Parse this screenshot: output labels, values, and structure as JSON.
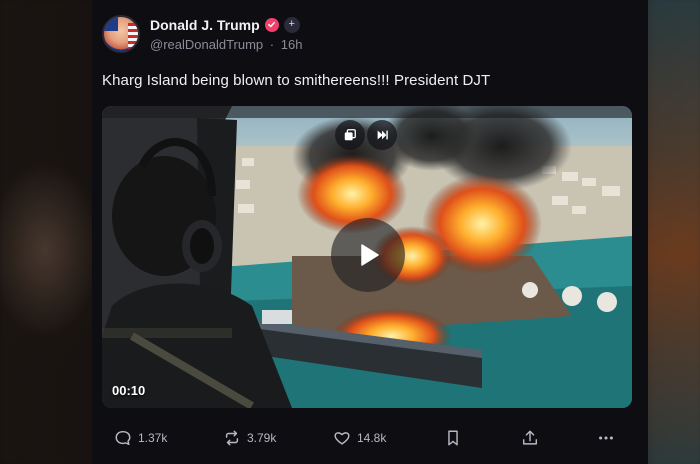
{
  "post": {
    "author": {
      "display_name": "Donald J. Trump",
      "handle": "@realDonaldTrump",
      "age": "16h",
      "separator": "·",
      "plus_badge": "+"
    },
    "text": "Kharg Island being blown to smithereens!!! President DJT",
    "media": {
      "duration": "00:10",
      "icons": [
        "repost-media-icon",
        "skip-forward-icon",
        "play-icon"
      ]
    },
    "actions": {
      "replies": "1.37k",
      "reposts": "3.79k",
      "likes": "14.8k",
      "bookmark_icon": "bookmark-icon",
      "share_icon": "share-icon",
      "more_icon": "more-icon"
    }
  },
  "colors": {
    "background": "#0d0d12",
    "verified_badge": "#f0406b",
    "text_primary": "#f0f0f4",
    "text_secondary": "#8b8b99"
  }
}
